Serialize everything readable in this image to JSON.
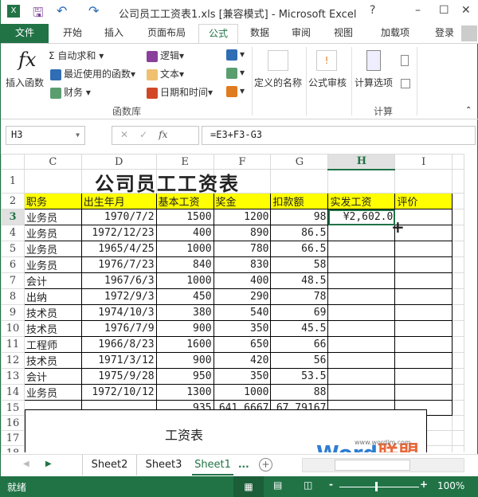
{
  "titlebar": {
    "title": "公司员工工资表1.xls  [兼容模式] - Microsoft Excel",
    "help": "?",
    "minimize": "–",
    "maximize": "☐",
    "close": "✕"
  },
  "tabs": [
    "文件",
    "开始",
    "插入",
    "页面布局",
    "公式",
    "数据",
    "审阅",
    "视图",
    "加载项"
  ],
  "active_tab": "公式",
  "login": "登录",
  "ribbon": {
    "insert_function": "插入函数",
    "autosum": "自动求和",
    "recent": "最近使用的函数",
    "finance": "财务",
    "logic": "逻辑",
    "text": "文本",
    "datetime": "日期和时间",
    "defined_names": "定义的名称",
    "formula_audit": "公式审核",
    "calc_options": "计算选项",
    "group_library": "函数库",
    "group_calc": "计算"
  },
  "formula_bar": {
    "name_box": "H3",
    "formula": "=E3+F3-G3"
  },
  "columns": [
    "C",
    "D",
    "E",
    "F",
    "G",
    "H",
    "I"
  ],
  "selected_column": "H",
  "selected_row": "3",
  "title": "公司员工工资表",
  "headers": [
    "职务",
    "出生年月",
    "基本工资",
    "奖金",
    "扣款额",
    "实发工资",
    "评价"
  ],
  "rows": [
    [
      "业务员",
      "1970/7/2",
      "1500",
      "1200",
      "98",
      "¥2,602.0",
      ""
    ],
    [
      "业务员",
      "1972/12/23",
      "400",
      "890",
      "86.5",
      "",
      ""
    ],
    [
      "业务员",
      "1965/4/25",
      "1000",
      "780",
      "66.5",
      "",
      ""
    ],
    [
      "业务员",
      "1976/7/23",
      "840",
      "830",
      "58",
      "",
      ""
    ],
    [
      "会计",
      "1967/6/3",
      "1000",
      "400",
      "48.5",
      "",
      ""
    ],
    [
      "出纳",
      "1972/9/3",
      "450",
      "290",
      "78",
      "",
      ""
    ],
    [
      "技术员",
      "1974/10/3",
      "380",
      "540",
      "69",
      "",
      ""
    ],
    [
      "技术员",
      "1976/7/9",
      "900",
      "350",
      "45.5",
      "",
      ""
    ],
    [
      "工程师",
      "1966/8/23",
      "1600",
      "650",
      "66",
      "",
      ""
    ],
    [
      "技术员",
      "1971/3/12",
      "900",
      "420",
      "56",
      "",
      ""
    ],
    [
      "会计",
      "1975/9/28",
      "950",
      "350",
      "53.5",
      "",
      ""
    ],
    [
      "业务员",
      "1972/10/12",
      "1300",
      "1000",
      "88",
      "",
      ""
    ],
    [
      "",
      "",
      "935",
      "641.6667",
      "67.79167",
      "",
      ""
    ]
  ],
  "chart_title": "工资表",
  "sheets": [
    "Sheet2",
    "Sheet3",
    "Sheet1"
  ],
  "active_sheet": "Sheet1",
  "more_sheets": "...",
  "watermark": {
    "url": "www.wordlm.com",
    "brand": "Word联盟"
  },
  "status": {
    "ready": "就绪",
    "zoom": "100%"
  },
  "accent": "#217346"
}
